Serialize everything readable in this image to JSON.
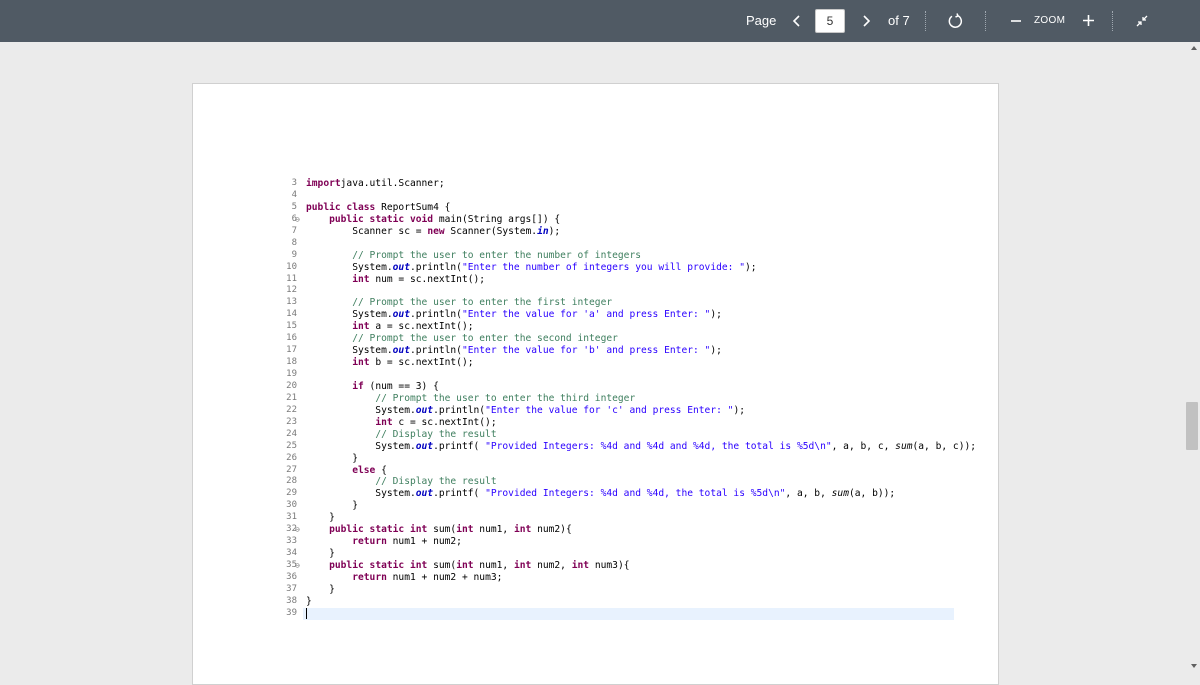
{
  "toolbar": {
    "page_label": "Page",
    "prev_icon": "chevron-left-icon",
    "current_page": "5",
    "next_icon": "chevron-right-icon",
    "of_pages": "of 7",
    "rotate_icon": "rotate-icon",
    "zoom_out_icon": "minus-icon",
    "zoom_label": "ZOOM",
    "zoom_in_icon": "plus-icon",
    "exit_fullscreen_icon": "collapse-arrows-icon"
  },
  "code_lines": [
    {
      "n": "3",
      "fold": false,
      "t": [
        [
          "kw",
          "import"
        ],
        [
          "",
          "java.util.Scanner;"
        ]
      ]
    },
    {
      "n": "4",
      "fold": false,
      "t": []
    },
    {
      "n": "5",
      "fold": false,
      "t": [
        [
          "kw",
          "public class"
        ],
        [
          "",
          " ReportSum4 {"
        ]
      ]
    },
    {
      "n": "6",
      "fold": true,
      "t": [
        [
          "",
          "    "
        ],
        [
          "kw",
          "public static void"
        ],
        [
          "",
          " main(String "
        ],
        [
          "",
          "args"
        ],
        [
          "",
          "[]) {"
        ]
      ]
    },
    {
      "n": "7",
      "fold": false,
      "t": [
        [
          "",
          "        Scanner "
        ],
        [
          "",
          "sc"
        ],
        [
          "",
          " = "
        ],
        [
          "kw",
          "new"
        ],
        [
          "",
          " Scanner(System."
        ],
        [
          "fld",
          "in"
        ],
        [
          "",
          ");"
        ]
      ]
    },
    {
      "n": "8",
      "fold": false,
      "t": []
    },
    {
      "n": "9",
      "fold": false,
      "t": [
        [
          "",
          "        "
        ],
        [
          "cm",
          "// Prompt the user to enter the number of integers"
        ]
      ]
    },
    {
      "n": "10",
      "fold": false,
      "t": [
        [
          "",
          "        System."
        ],
        [
          "fld",
          "out"
        ],
        [
          "",
          ".println("
        ],
        [
          "str",
          "\"Enter the number of integers you will provide: \""
        ],
        [
          "",
          ");"
        ]
      ]
    },
    {
      "n": "11",
      "fold": false,
      "t": [
        [
          "",
          "        "
        ],
        [
          "kw",
          "int"
        ],
        [
          "",
          " num = sc.nextInt();"
        ]
      ]
    },
    {
      "n": "12",
      "fold": false,
      "t": []
    },
    {
      "n": "13",
      "fold": false,
      "t": [
        [
          "",
          "        "
        ],
        [
          "cm",
          "// Prompt the user to enter the first integer"
        ]
      ]
    },
    {
      "n": "14",
      "fold": false,
      "t": [
        [
          "",
          "        System."
        ],
        [
          "fld",
          "out"
        ],
        [
          "",
          ".println("
        ],
        [
          "str",
          "\"Enter the value for 'a' and press Enter: \""
        ],
        [
          "",
          ");"
        ]
      ]
    },
    {
      "n": "15",
      "fold": false,
      "t": [
        [
          "",
          "        "
        ],
        [
          "kw",
          "int"
        ],
        [
          "",
          " a = sc.nextInt();"
        ]
      ]
    },
    {
      "n": "16",
      "fold": false,
      "t": [
        [
          "",
          "        "
        ],
        [
          "cm",
          "// Prompt the user to enter the second integer"
        ]
      ]
    },
    {
      "n": "17",
      "fold": false,
      "t": [
        [
          "",
          "        System."
        ],
        [
          "fld",
          "out"
        ],
        [
          "",
          ".println("
        ],
        [
          "str",
          "\"Enter the value for 'b' and press Enter: \""
        ],
        [
          "",
          ");"
        ]
      ]
    },
    {
      "n": "18",
      "fold": false,
      "t": [
        [
          "",
          "        "
        ],
        [
          "kw",
          "int"
        ],
        [
          "",
          " b = sc.nextInt();"
        ]
      ]
    },
    {
      "n": "19",
      "fold": false,
      "t": []
    },
    {
      "n": "20",
      "fold": false,
      "t": [
        [
          "",
          "        "
        ],
        [
          "kw",
          "if"
        ],
        [
          "",
          " (num == 3) {"
        ]
      ]
    },
    {
      "n": "21",
      "fold": false,
      "t": [
        [
          "",
          "            "
        ],
        [
          "cm",
          "// Prompt the user to enter the third integer"
        ]
      ]
    },
    {
      "n": "22",
      "fold": false,
      "t": [
        [
          "",
          "            System."
        ],
        [
          "fld",
          "out"
        ],
        [
          "",
          ".println("
        ],
        [
          "str",
          "\"Enter the value for 'c' and press Enter: \""
        ],
        [
          "",
          ");"
        ]
      ]
    },
    {
      "n": "23",
      "fold": false,
      "t": [
        [
          "",
          "            "
        ],
        [
          "kw",
          "int"
        ],
        [
          "",
          " c = sc.nextInt();"
        ]
      ]
    },
    {
      "n": "24",
      "fold": false,
      "t": [
        [
          "",
          "            "
        ],
        [
          "cm",
          "// Display the result"
        ]
      ]
    },
    {
      "n": "25",
      "fold": false,
      "t": [
        [
          "",
          "            System."
        ],
        [
          "fld",
          "out"
        ],
        [
          "",
          ".printf( "
        ],
        [
          "str",
          "\"Provided Integers: %4d and %4d and %4d, the total is %5d\\n\""
        ],
        [
          "",
          ", a, b, c, "
        ],
        [
          "mi",
          "sum"
        ],
        [
          "",
          "(a, b, c));"
        ]
      ]
    },
    {
      "n": "26",
      "fold": false,
      "t": [
        [
          "",
          "        }"
        ]
      ]
    },
    {
      "n": "27",
      "fold": false,
      "t": [
        [
          "",
          "        "
        ],
        [
          "kw",
          "else"
        ],
        [
          "",
          " {"
        ]
      ]
    },
    {
      "n": "28",
      "fold": false,
      "t": [
        [
          "",
          "            "
        ],
        [
          "cm",
          "// Display the result"
        ]
      ]
    },
    {
      "n": "29",
      "fold": false,
      "t": [
        [
          "",
          "            System."
        ],
        [
          "fld",
          "out"
        ],
        [
          "",
          ".printf( "
        ],
        [
          "str",
          "\"Provided Integers: %4d and %4d, the total is %5d\\n\""
        ],
        [
          "",
          ", a, b, "
        ],
        [
          "mi",
          "sum"
        ],
        [
          "",
          "(a, b));"
        ]
      ]
    },
    {
      "n": "30",
      "fold": false,
      "t": [
        [
          "",
          "        }"
        ]
      ]
    },
    {
      "n": "31",
      "fold": false,
      "t": [
        [
          "",
          "    }"
        ]
      ]
    },
    {
      "n": "32",
      "fold": true,
      "t": [
        [
          "",
          "    "
        ],
        [
          "kw",
          "public static int"
        ],
        [
          "",
          " sum("
        ],
        [
          "kw",
          "int"
        ],
        [
          "",
          " num1, "
        ],
        [
          "kw",
          "int"
        ],
        [
          "",
          " num2){"
        ]
      ]
    },
    {
      "n": "33",
      "fold": false,
      "t": [
        [
          "",
          "        "
        ],
        [
          "kw",
          "return"
        ],
        [
          "",
          " num1 + num2;"
        ]
      ]
    },
    {
      "n": "34",
      "fold": false,
      "t": [
        [
          "",
          "    }"
        ]
      ]
    },
    {
      "n": "35",
      "fold": true,
      "t": [
        [
          "",
          "    "
        ],
        [
          "kw",
          "public static int"
        ],
        [
          "",
          " sum("
        ],
        [
          "kw",
          "int"
        ],
        [
          "",
          " num1, "
        ],
        [
          "kw",
          "int"
        ],
        [
          "",
          " num2, "
        ],
        [
          "kw",
          "int"
        ],
        [
          "",
          " num3){"
        ]
      ]
    },
    {
      "n": "36",
      "fold": false,
      "t": [
        [
          "",
          "        "
        ],
        [
          "kw",
          "return"
        ],
        [
          "",
          " num1 + num2 + num3;"
        ]
      ]
    },
    {
      "n": "37",
      "fold": false,
      "t": [
        [
          "",
          "    }"
        ]
      ]
    },
    {
      "n": "38",
      "fold": false,
      "t": [
        [
          "",
          "}"
        ]
      ]
    },
    {
      "n": "39",
      "fold": false,
      "caret": true,
      "highlight": true,
      "t": []
    }
  ]
}
